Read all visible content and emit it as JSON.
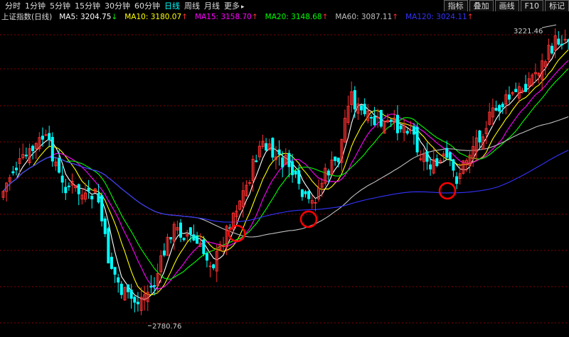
{
  "toolbar": {
    "periods": [
      "分时",
      "1分钟",
      "5分钟",
      "15分钟",
      "30分钟",
      "60分钟",
      "日线",
      "周线",
      "月线",
      "更多"
    ],
    "active_period": "日线",
    "more_arrow": "▸",
    "buttons": [
      "指标",
      "叠加",
      "画线",
      "F10",
      "标记"
    ]
  },
  "legend": {
    "index_name": "上证指数(日线)",
    "items": [
      {
        "label": "MA5: 3204.75",
        "arrow": "↓",
        "color": "#ffffff",
        "arrow_color": "#00ff00"
      },
      {
        "label": "MA10: 3180.07",
        "arrow": "↑",
        "color": "#ffff00",
        "arrow_color": "#ff3030"
      },
      {
        "label": "MA15: 3158.70",
        "arrow": "↑",
        "color": "#ff00ff",
        "arrow_color": "#ff3030"
      },
      {
        "label": "MA20: 3148.68",
        "arrow": "↑",
        "color": "#00ff00",
        "arrow_color": "#ff3030"
      },
      {
        "label": "MA60: 3087.11",
        "arrow": "↑",
        "color": "#c0c0c0",
        "arrow_color": "#ff3030"
      },
      {
        "label": "MA120: 3024.11",
        "arrow": "↑",
        "color": "#3333ff",
        "arrow_color": "#ff3030"
      }
    ]
  },
  "annotations": {
    "high_label": "3221.46",
    "low_label": "2780.76"
  },
  "colors": {
    "up": "#ff3030",
    "down": "#00ffff",
    "grid": "#8a0000",
    "background": "#000000",
    "highlight_circle": "#ff0000"
  },
  "chart_data": {
    "type": "candlestick",
    "high": 3221.46,
    "low": 2780.76,
    "series": [
      {
        "name": "MA5"
      },
      {
        "name": "MA10"
      },
      {
        "name": "MA15"
      },
      {
        "name": "MA20"
      },
      {
        "name": "MA60"
      },
      {
        "name": "MA120"
      }
    ],
    "highlight_circle_count": 3
  }
}
